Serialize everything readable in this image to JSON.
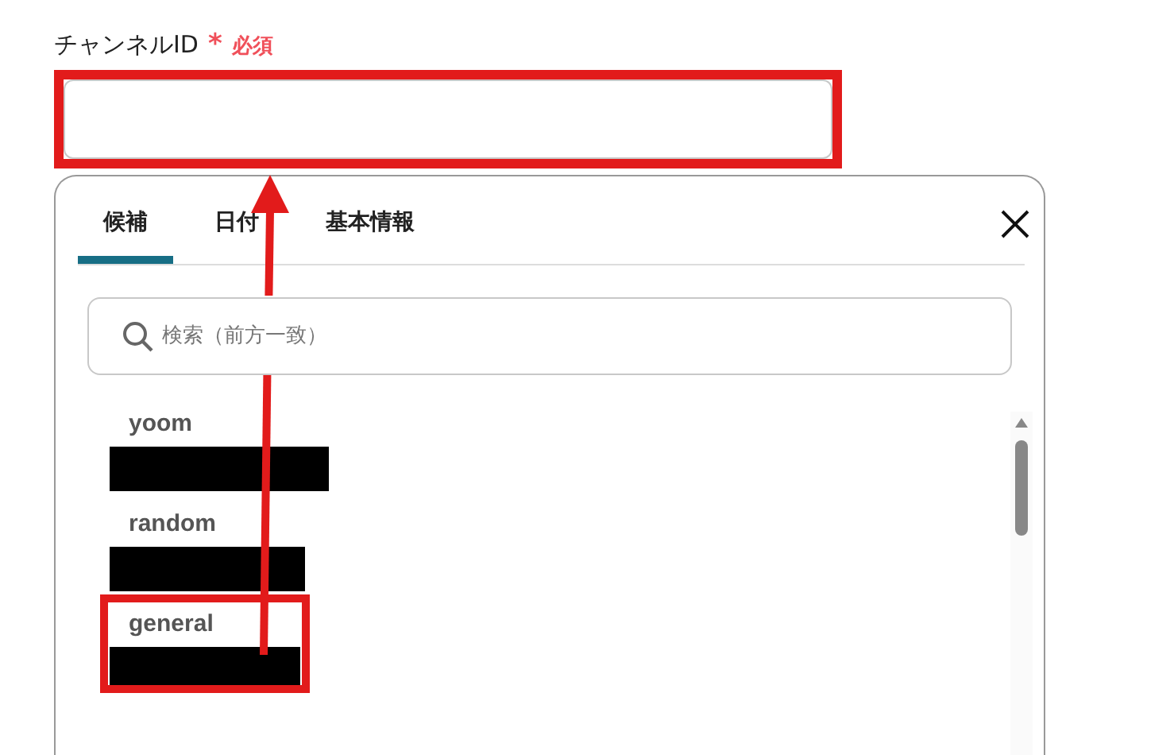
{
  "field": {
    "label": "チャンネルID",
    "required_mark": "*",
    "required_label": "必須",
    "highlighted": true
  },
  "picker": {
    "tabs": [
      {
        "label": "候補",
        "selected": true
      },
      {
        "label": "日付",
        "selected": false
      },
      {
        "label": "基本情報",
        "selected": false
      }
    ],
    "search": {
      "placeholder": "検索（前方一致）"
    },
    "items": [
      {
        "name": "yoom",
        "highlighted": false
      },
      {
        "name": "random",
        "highlighted": false
      },
      {
        "name": "general",
        "highlighted": true
      }
    ]
  }
}
